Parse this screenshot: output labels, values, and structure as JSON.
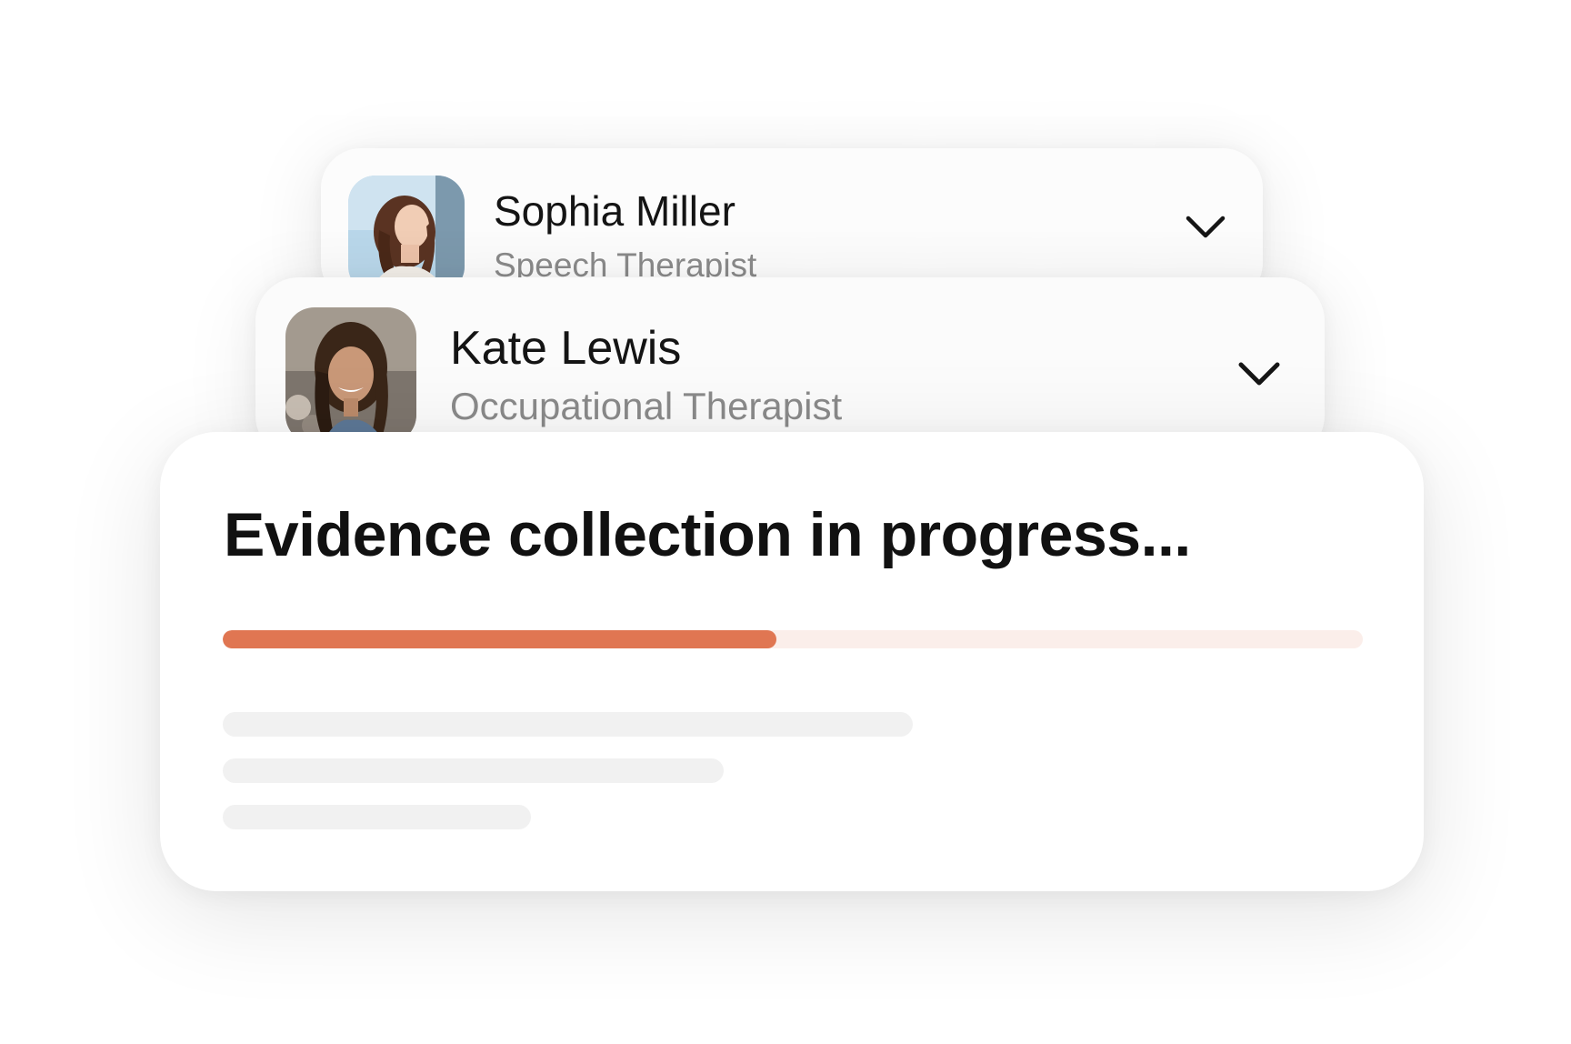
{
  "therapists": [
    {
      "name": "Sophia Miller",
      "role": "Speech Therapist",
      "avatar_icon": "sophia-miller-photo"
    },
    {
      "name": "Kate Lewis",
      "role": "Occupational Therapist",
      "avatar_icon": "kate-lewis-photo"
    }
  ],
  "progress_card": {
    "title": "Evidence collection in progress...",
    "progress_fraction": 0.486,
    "skeleton_line_count": 3
  },
  "colors": {
    "accent": "#e07652",
    "track": "#fbeeea",
    "skeleton": "#f1f1f1",
    "muted_text": "#8a8a8a"
  },
  "icons": {
    "expand": "chevron-down-icon"
  }
}
